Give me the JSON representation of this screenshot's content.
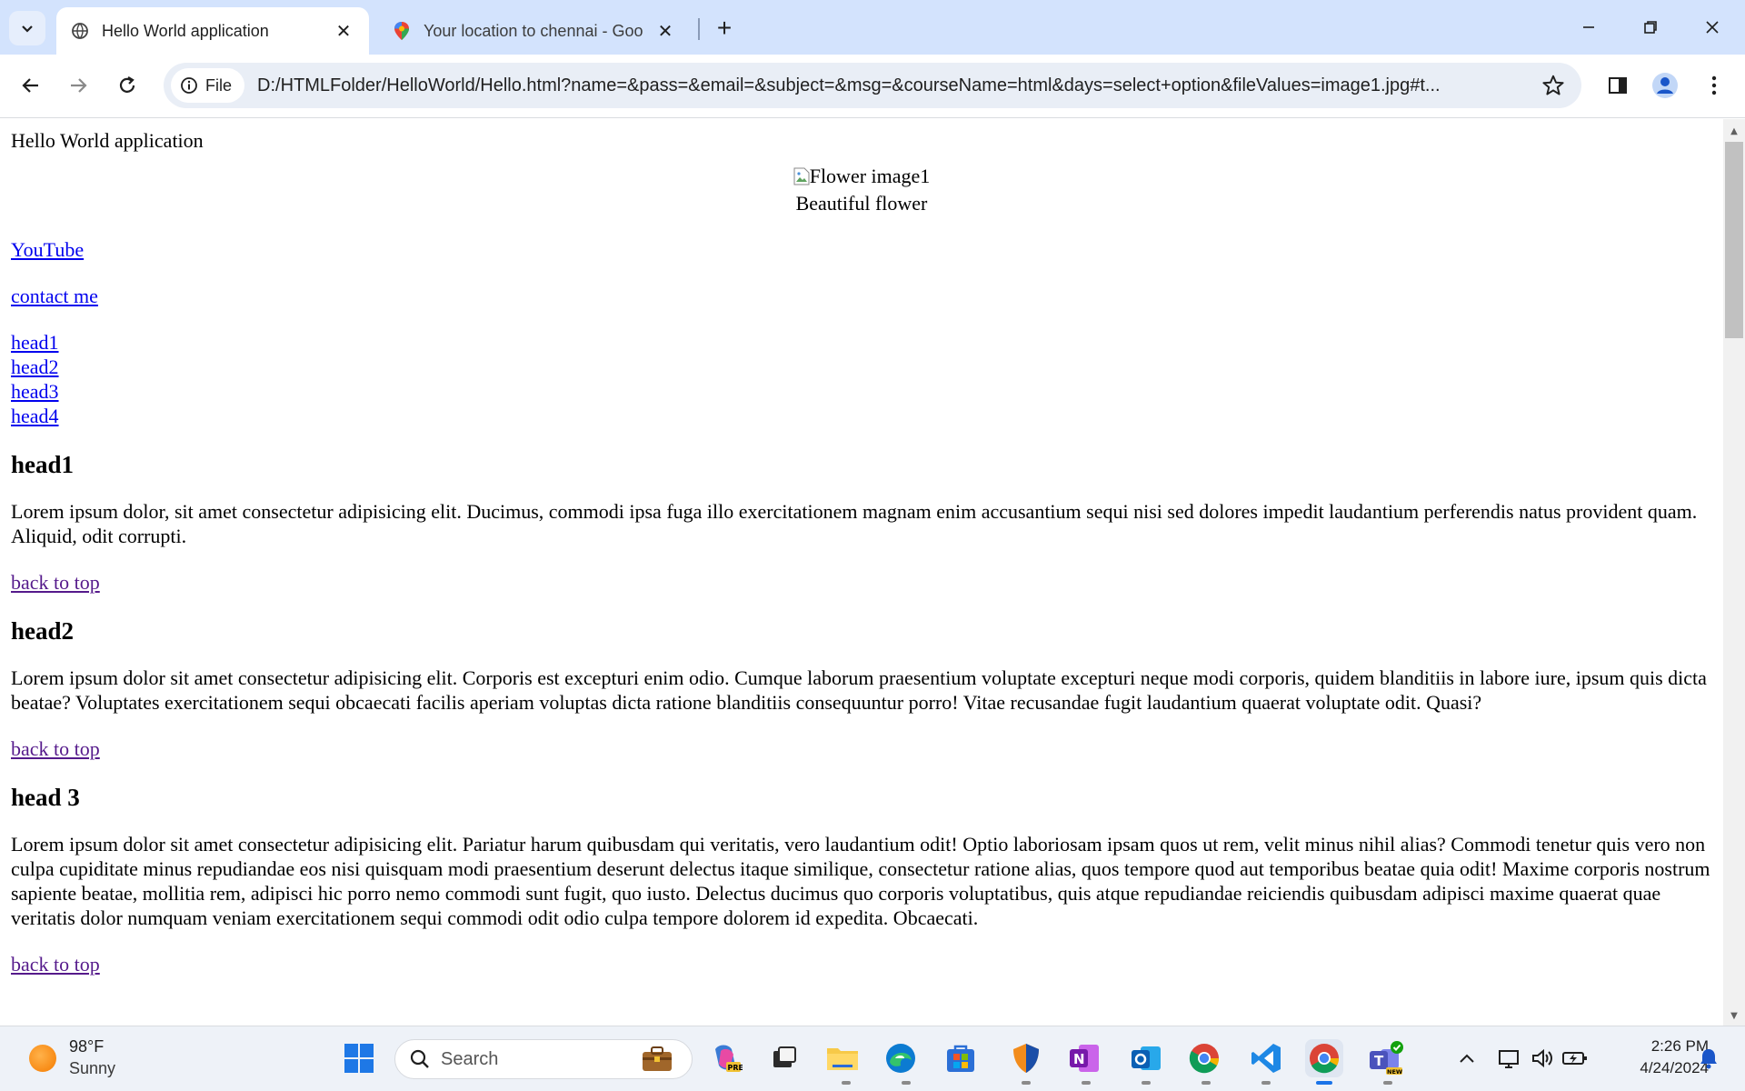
{
  "browser": {
    "tabs": [
      {
        "title": "Hello World application",
        "active": true
      },
      {
        "title": "Your location to chennai - Goo",
        "active": false
      }
    ],
    "site_chip": "File",
    "url": "D:/HTMLFolder/HelloWorld/Hello.html?name=&pass=&email=&subject=&msg=&courseName=html&days=select+option&fileValues=image1.jpg#t..."
  },
  "page": {
    "title_text": "Hello World application",
    "image_alt": "Flower image1",
    "caption": "Beautiful flower",
    "links": {
      "youtube": "YouTube",
      "contact": "contact me"
    },
    "toc": [
      "head1",
      "head2",
      "head3",
      "head4"
    ],
    "sections": [
      {
        "heading": "head1",
        "text": "Lorem ipsum dolor, sit amet consectetur adipisicing elit. Ducimus, commodi ipsa fuga illo exercitationem magnam enim accusantium sequi nisi sed dolores impedit laudantium perferendis natus provident quam. Aliquid, odit corrupti.",
        "back": "back to top"
      },
      {
        "heading": "head2",
        "text": "Lorem ipsum dolor sit amet consectetur adipisicing elit. Corporis est excepturi enim odio. Cumque laborum praesentium voluptate excepturi neque modi corporis, quidem blanditiis in labore iure, ipsum quis dicta beatae? Voluptates exercitationem sequi obcaecati facilis aperiam voluptas dicta ratione blanditiis consequuntur porro! Vitae recusandae fugit laudantium quaerat voluptate odit. Quasi?",
        "back": "back to top"
      },
      {
        "heading": "head 3",
        "text": "Lorem ipsum dolor sit amet consectetur adipisicing elit. Pariatur harum quibusdam qui veritatis, vero laudantium odit! Optio laboriosam ipsam quos ut rem, velit minus nihil alias? Commodi tenetur quis vero non culpa cupiditate minus repudiandae eos nisi quisquam modi praesentium deserunt delectus itaque similique, consectetur ratione alias, quos tempore quod aut temporibus beatae quia odit! Maxime corporis nostrum sapiente beatae, mollitia rem, adipisci hic porro nemo commodi sunt fugit, quo iusto. Delectus ducimus quo corporis voluptatibus, quis atque repudiandae reiciendis quibusdam adipisci maxime quaerat quae veritatis dolor numquam veniam exercitationem sequi commodi odit odio culpa tempore dolorem id expedita. Obcaecati.",
        "back": "back to top"
      }
    ]
  },
  "taskbar": {
    "weather_temp": "98°F",
    "weather_desc": "Sunny",
    "search_label": "Search",
    "time": "2:26 PM",
    "date": "4/24/2024"
  },
  "colors": {
    "link": "#0000ee",
    "visited": "#551a8b",
    "chrome_bg": "#d3e3fd"
  }
}
